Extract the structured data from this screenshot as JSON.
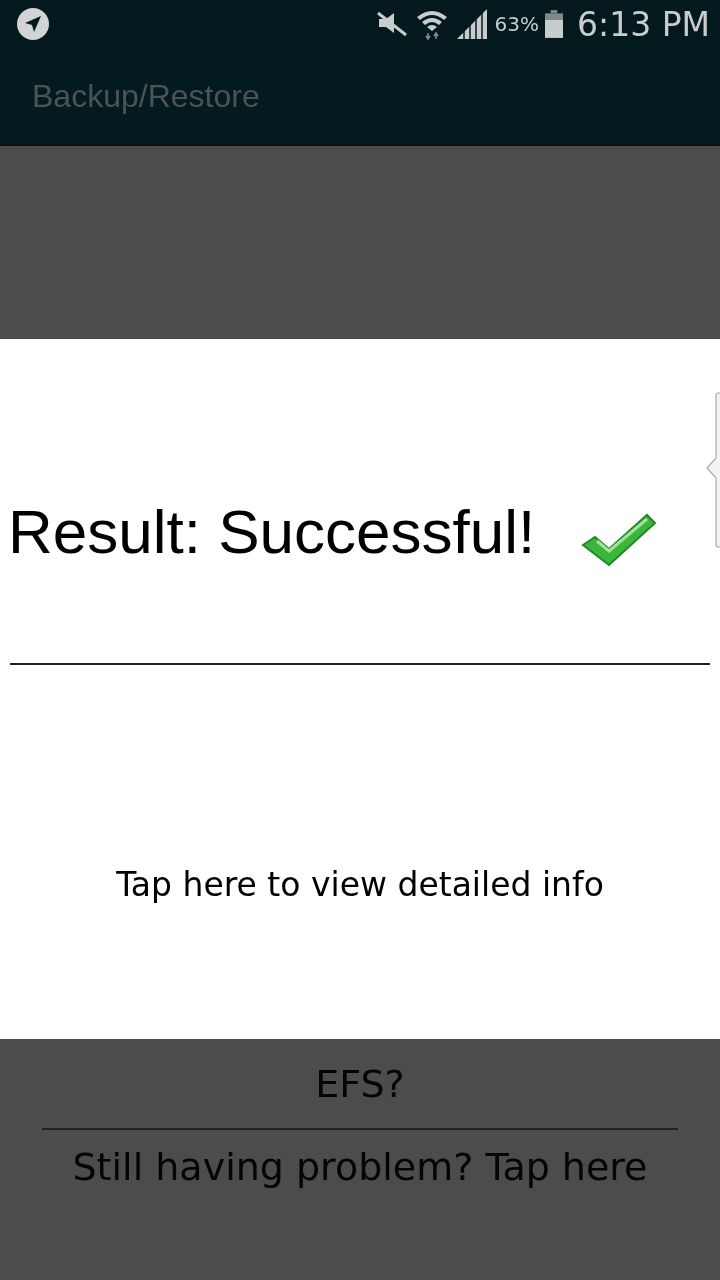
{
  "status_bar": {
    "battery": "63%",
    "time": "6:13 PM"
  },
  "app_bar": {
    "title": "Backup/Restore"
  },
  "screen": {
    "items": [
      {
        "label": "EFS?"
      },
      {
        "label": "Still having problem? Tap here"
      }
    ]
  },
  "dialog": {
    "title": "Result: Successful!",
    "link": "Tap here to view detailed info"
  }
}
